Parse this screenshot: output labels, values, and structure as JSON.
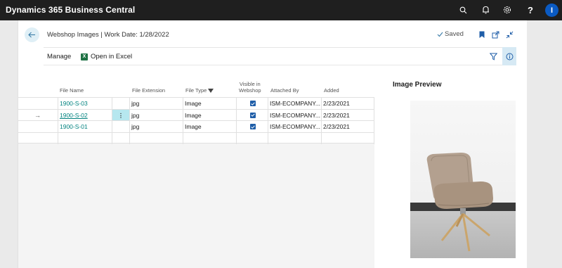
{
  "app": {
    "title": "Dynamics 365 Business Central",
    "user_initial": "I"
  },
  "topbar": {
    "icons": [
      "search-icon",
      "bell-icon",
      "gear-icon",
      "help-icon"
    ],
    "help_label": "?"
  },
  "page": {
    "title": "Webshop Images | Work Date: 1/28/2022",
    "status": "Saved"
  },
  "actions": {
    "manage": "Manage",
    "open_in_excel": "Open in Excel",
    "excel_glyph": "X"
  },
  "table": {
    "headers": {
      "file_name": "File Name",
      "file_extension": "File Extension",
      "file_type": "File Type",
      "visible_line1": "Visible in",
      "visible_line2": "Webshop",
      "attached_by": "Attached By",
      "added": "Added"
    },
    "rows": [
      {
        "arrow": "",
        "file_name": "1900-S-03",
        "menu": "",
        "file_extension": "jpg",
        "file_type": "Image",
        "visible": true,
        "attached_by": "ISM-ECOMPANY...",
        "added": "2/23/2021"
      },
      {
        "arrow": "→",
        "file_name": "1900-S-02",
        "menu": "⋮",
        "file_extension": "jpg",
        "file_type": "Image",
        "visible": true,
        "attached_by": "ISM-ECOMPANY...",
        "added": "2/23/2021"
      },
      {
        "arrow": "",
        "file_name": "1900-S-01",
        "menu": "",
        "file_extension": "jpg",
        "file_type": "Image",
        "visible": true,
        "attached_by": "ISM-ECOMPANY...",
        "added": "2/23/2021"
      },
      {
        "arrow": "",
        "file_name": "",
        "menu": "",
        "file_extension": "",
        "file_type": "",
        "visible": false,
        "attached_by": "",
        "added": ""
      }
    ]
  },
  "preview": {
    "title": "Image Preview"
  },
  "colors": {
    "accent": "#00827f",
    "topbar": "#1f1f1f",
    "avatar": "#0a5ac2",
    "checkbox": "#1f5ea8",
    "selected_cell": "#b6e7ef"
  }
}
